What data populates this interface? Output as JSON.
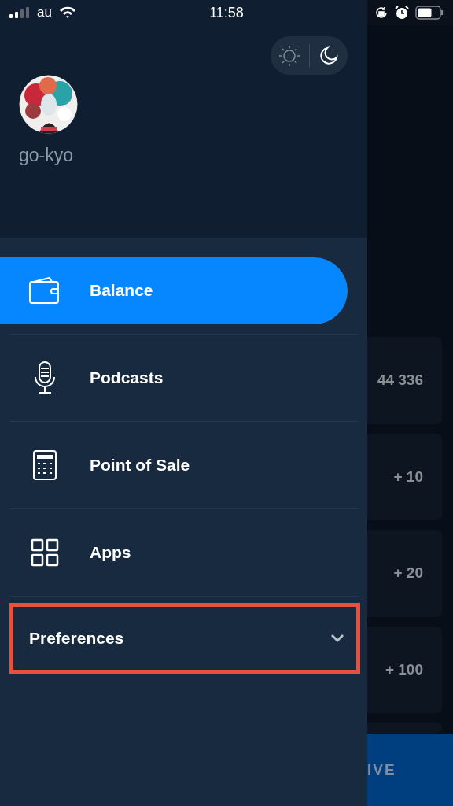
{
  "status_bar": {
    "carrier": "au",
    "time": "11:58"
  },
  "theme_toggle": [
    {
      "kind": "light",
      "selected": false
    },
    {
      "kind": "dark",
      "selected": true
    }
  ],
  "profile": {
    "name": "go-kyo"
  },
  "menu": [
    {
      "kind": "wallet",
      "label": "Balance",
      "selected": true
    },
    {
      "kind": "microphone",
      "label": "Podcasts",
      "selected": false
    },
    {
      "kind": "calculator",
      "label": "Point of Sale",
      "selected": false
    },
    {
      "kind": "grid",
      "label": "Apps",
      "selected": false
    }
  ],
  "preferences": {
    "label": "Preferences",
    "expanded": false,
    "highlighted": true
  },
  "background_cards": [
    "44 336",
    "+ 10",
    "+ 20",
    "+ 100"
  ],
  "background_button": {
    "label": "IVE"
  }
}
